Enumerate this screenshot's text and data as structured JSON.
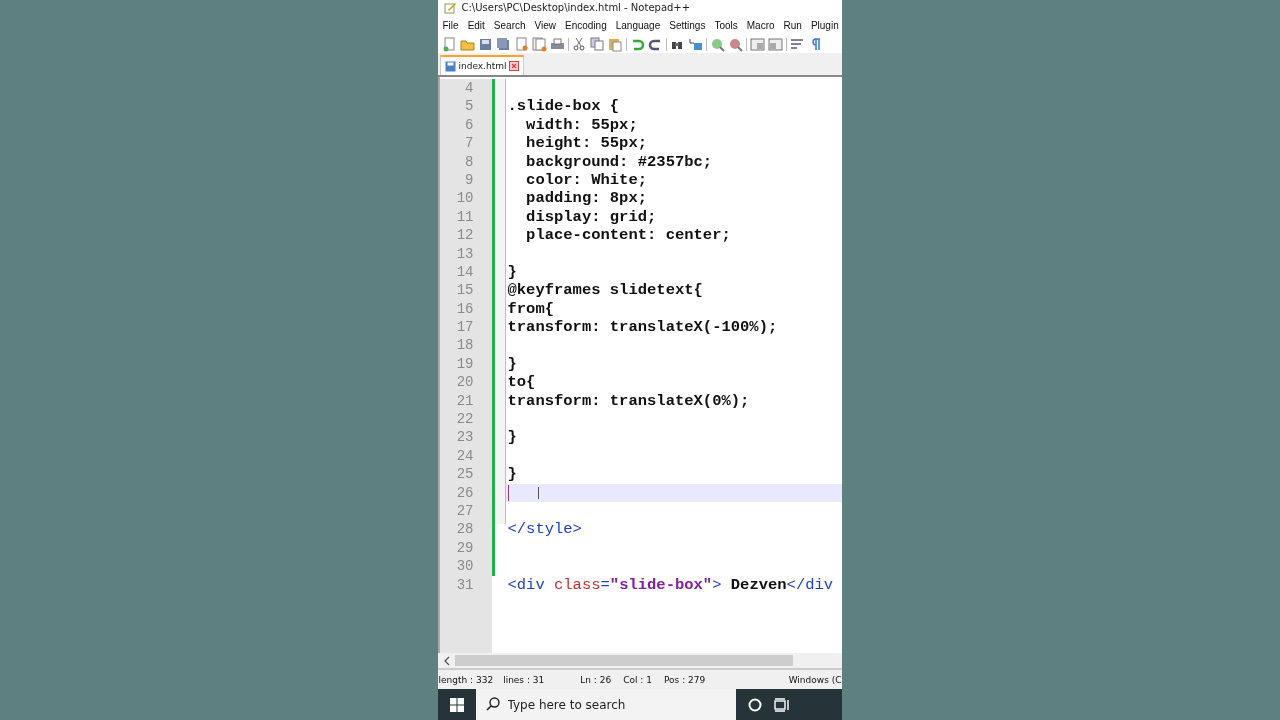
{
  "window": {
    "title": "C:\\Users\\PC\\Desktop\\index.html - Notepad++"
  },
  "menu": [
    "File",
    "Edit",
    "Search",
    "View",
    "Encoding",
    "Language",
    "Settings",
    "Tools",
    "Macro",
    "Run",
    "Plugin"
  ],
  "tabs": [
    {
      "label": "index.html",
      "selected": true
    }
  ],
  "editor": {
    "lines": [
      {
        "number": "4",
        "current": false
      },
      {
        "number": "5",
        "current": false,
        "segments": [
          {
            "kind": "plain",
            "text": ".slide-box {"
          }
        ]
      },
      {
        "number": "6",
        "current": false,
        "segments": [
          {
            "kind": "plain",
            "text": "  width: 55px;"
          }
        ]
      },
      {
        "number": "7",
        "current": false,
        "segments": [
          {
            "kind": "plain",
            "text": "  height: 55px;"
          }
        ]
      },
      {
        "number": "8",
        "current": false,
        "segments": [
          {
            "kind": "plain",
            "text": "  background: #2357bc;"
          }
        ]
      },
      {
        "number": "9",
        "current": false,
        "segments": [
          {
            "kind": "plain",
            "text": "  color: White;"
          }
        ]
      },
      {
        "number": "10",
        "current": false,
        "segments": [
          {
            "kind": "plain",
            "text": "  padding: 8px;"
          }
        ]
      },
      {
        "number": "11",
        "current": false,
        "segments": [
          {
            "kind": "plain",
            "text": "  display: grid;"
          }
        ]
      },
      {
        "number": "12",
        "current": false,
        "segments": [
          {
            "kind": "plain",
            "text": "  place-content: center;"
          }
        ]
      },
      {
        "number": "13",
        "current": false
      },
      {
        "number": "14",
        "current": false,
        "segments": [
          {
            "kind": "plain",
            "text": "}"
          }
        ]
      },
      {
        "number": "15",
        "current": false,
        "segments": [
          {
            "kind": "plain",
            "text": "@keyframes slidetext{"
          }
        ]
      },
      {
        "number": "16",
        "current": false,
        "segments": [
          {
            "kind": "plain",
            "text": "from{"
          }
        ]
      },
      {
        "number": "17",
        "current": false,
        "segments": [
          {
            "kind": "plain",
            "text": "transform: translateX(-100%);"
          }
        ]
      },
      {
        "number": "18",
        "current": false
      },
      {
        "number": "19",
        "current": false,
        "segments": [
          {
            "kind": "plain",
            "text": "}"
          }
        ]
      },
      {
        "number": "20",
        "current": false,
        "segments": [
          {
            "kind": "plain",
            "text": "to{"
          }
        ]
      },
      {
        "number": "21",
        "current": false,
        "segments": [
          {
            "kind": "plain",
            "text": "transform: translateX(0%);"
          }
        ]
      },
      {
        "number": "22",
        "current": false
      },
      {
        "number": "23",
        "current": false,
        "segments": [
          {
            "kind": "plain",
            "text": "}"
          }
        ]
      },
      {
        "number": "24",
        "current": false
      },
      {
        "number": "25",
        "current": false,
        "segments": [
          {
            "kind": "plain",
            "text": "}"
          }
        ]
      },
      {
        "number": "26",
        "current": true
      },
      {
        "number": "27",
        "current": false
      },
      {
        "number": "28",
        "current": false,
        "segments": [
          {
            "kind": "tag",
            "text": "</style>"
          }
        ]
      },
      {
        "number": "29",
        "current": false
      },
      {
        "number": "30",
        "current": false
      },
      {
        "number": "31",
        "current": false,
        "segments": [
          {
            "kind": "tag",
            "text": "<div "
          },
          {
            "kind": "attr",
            "text": "class"
          },
          {
            "kind": "tag",
            "text": "="
          },
          {
            "kind": "string",
            "text": "\"slide-box\""
          },
          {
            "kind": "tag",
            "text": ">"
          },
          {
            "kind": "plain",
            "text": " Dezven"
          },
          {
            "kind": "tag",
            "text": "</div"
          }
        ]
      }
    ]
  },
  "status_bar": [
    "length : 332",
    "lines : 31",
    "Ln : 26",
    "Col : 1",
    "Pos : 279",
    "Windows (C"
  ],
  "taskbar": {
    "search": {
      "placeholder": "Type here to search"
    }
  }
}
